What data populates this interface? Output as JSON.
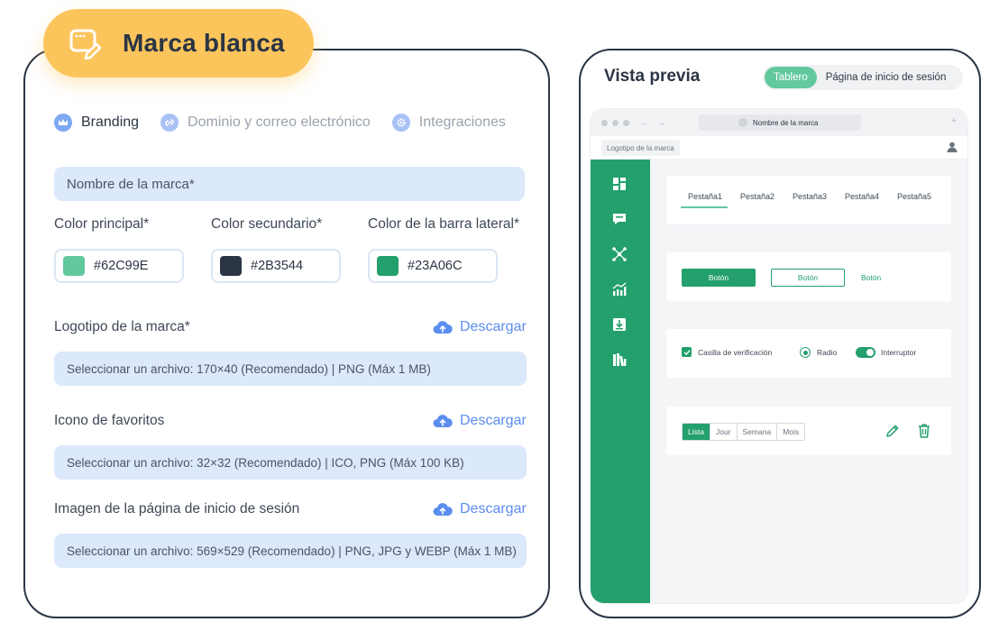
{
  "header": {
    "title": "Marca blanca",
    "icon": "edit-window-icon"
  },
  "tabs": [
    {
      "label": "Branding",
      "icon": "crown-icon",
      "active": true
    },
    {
      "label": "Dominio y correo electrónico",
      "icon": "link-icon",
      "active": false
    },
    {
      "label": "Integraciones",
      "icon": "gear-icon",
      "active": false
    }
  ],
  "brand_name": {
    "placeholder": "Nombre de la marca*"
  },
  "colors": {
    "primary": {
      "label": "Color principal*",
      "value": "#62C99E"
    },
    "secondary": {
      "label": "Color secundario*",
      "value": "#2B3544"
    },
    "sidebar": {
      "label": "Color de la barra lateral*",
      "value": "#23A06C"
    }
  },
  "uploads": {
    "logo": {
      "label": "Logotipo de la marca*",
      "download": "Descargar",
      "hint": "Seleccionar un archivo: 170×40 (Recomendado) | PNG (Máx 1 MB)"
    },
    "favicon": {
      "label": "Icono de favoritos",
      "download": "Descargar",
      "hint": "Seleccionar un archivo: 32×32 (Recomendado) | ICO, PNG (Máx 100 KB)"
    },
    "login_image": {
      "label": "Imagen de la página de inicio de sesión",
      "download": "Descargar",
      "hint": "Seleccionar un archivo: 569×529 (Recomendado) | PNG, JPG y WEBP (Máx 1 MB)"
    }
  },
  "preview": {
    "title": "Vista previa",
    "toggle": {
      "options": [
        "Tablero",
        "Página de inicio de sesión"
      ],
      "selected": "Tablero"
    },
    "browser": {
      "url_text": "Nombre de la marca",
      "logo_text": "Logotipo de la marca"
    },
    "tabs": [
      "Pestaña1",
      "Pestaña2",
      "Pestaña3",
      "Pestaña4",
      "Pestaña5"
    ],
    "buttons": [
      "Botón",
      "Botón",
      "Botón"
    ],
    "controls": {
      "checkbox": "Casilla de verificación",
      "radio": "Radio",
      "switch": "Interruptor"
    },
    "segments": {
      "items": [
        "Lista",
        "Jour",
        "Semana",
        "Mois"
      ],
      "selected": "Lista"
    },
    "sidebar_icons": [
      "dashboard-icon",
      "chat-icon",
      "network-icon",
      "chart-icon",
      "download-icon",
      "books-icon"
    ]
  },
  "palette": {
    "badge": "#FCC55C",
    "accent_blue": "#5B8DEF",
    "sidebar_green": "#23A06C",
    "light_green": "#62C99E"
  }
}
